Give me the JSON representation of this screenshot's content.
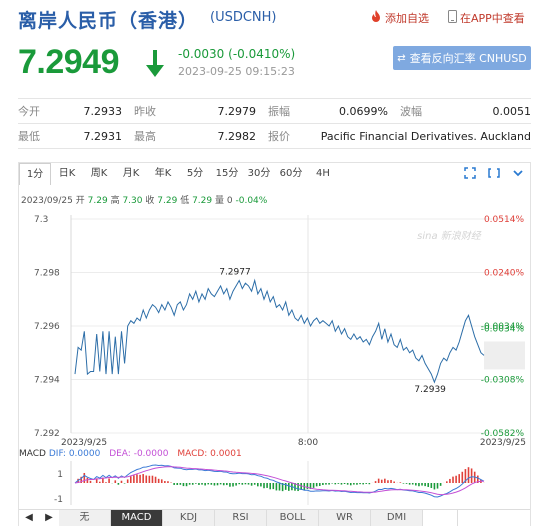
{
  "header": {
    "title": "离岸人民币（香港）",
    "code": "(USDCNH)",
    "favorite_label": "添加自选",
    "app_label": "在APP中查看"
  },
  "quote": {
    "price": "7.2949",
    "change": "-0.0030 (-0.0410%)",
    "time": "2023-09-25 09:15:23",
    "cross_label": "查看反向汇率 CNHUSD",
    "rows": [
      [
        {
          "label": "今开",
          "value": "7.2933"
        },
        {
          "label": "昨收",
          "value": "7.2979"
        },
        {
          "label": "振幅",
          "value": "0.0699%"
        },
        {
          "label": "波幅",
          "value": "0.0051"
        }
      ],
      [
        {
          "label": "最低",
          "value": "7.2931"
        },
        {
          "label": "最高",
          "value": "7.2982"
        },
        {
          "label": "报价",
          "value": "Pacific Financial Derivatives. Auckland"
        }
      ]
    ]
  },
  "chart": {
    "tabs": [
      "1分",
      "日K",
      "周K",
      "月K",
      "年K",
      "5分",
      "15分",
      "30分",
      "60分",
      "4H"
    ],
    "active_tab": "1分",
    "info": {
      "date": "2023/09/25",
      "open_label": "开",
      "open": "7.29",
      "high_label": "高",
      "high": "7.30",
      "close_label": "收",
      "close": "7.29",
      "low_label": "低",
      "low": "7.29",
      "vol_label": "量",
      "vol": "0",
      "pct": "-0.04%"
    },
    "watermark": "sina 新浪财经",
    "high_marker": "7.2977",
    "low_marker": "7.2939",
    "x_labels": [
      "2023/9/25",
      "8:00",
      "2023/9/25"
    ],
    "indicator_tabs": [
      "无",
      "MACD",
      "KDJ",
      "RSI",
      "BOLL",
      "WR",
      "DMI"
    ],
    "active_indicator": "MACD",
    "macd_legend": {
      "name": "MACD",
      "dif": "DIF: 0.0000",
      "dea": "DEA: -0.0000",
      "macd": "MACD: 0.0001"
    },
    "macd_ticks": [
      "1",
      "-1"
    ],
    "colors": {
      "line": "#2d6ea8",
      "up": "#e0403a",
      "down": "#1a9a3a",
      "dif": "#3b7ad6",
      "dea": "#c34fd6"
    }
  },
  "chart_data": {
    "type": "line",
    "title": "",
    "xlabel": "",
    "ylabel": "",
    "x_range": [
      "2023/9/25",
      "2023/9/25"
    ],
    "ylim": [
      7.292,
      7.3
    ],
    "y_ticks_left": [
      "7.3",
      "7.298",
      "7.296",
      "7.294",
      "7.292"
    ],
    "y_ticks_right": [
      "0.0514%",
      "0.0240%",
      "-0.0034%",
      "-0.0308%",
      "-0.0582%"
    ],
    "right_tick_colors": [
      "#e0403a",
      "#e0403a",
      "#1a9a3a",
      "#1a9a3a",
      "#1a9a3a"
    ],
    "prev_close": 7.2979,
    "current_pct_label": "-0.0034%",
    "series": [
      {
        "values": [
          7.2942,
          7.2952,
          7.2951,
          7.2958,
          7.2942,
          7.2943,
          7.2943,
          7.2957,
          7.2943,
          7.2958,
          7.2942,
          7.2958,
          7.2942,
          7.2956,
          7.2942,
          7.2958,
          7.2946,
          7.296,
          7.2962,
          7.2961,
          7.2963,
          7.2962,
          7.2966,
          7.2963,
          7.2966,
          7.2968,
          7.2967,
          7.2965,
          7.2968,
          7.2966,
          7.2969,
          7.2967,
          7.2964,
          7.2968,
          7.2969,
          7.2966,
          7.2968,
          7.2972,
          7.297,
          7.2973,
          7.2969,
          7.2972,
          7.297,
          7.2974,
          7.2972,
          7.2971,
          7.2973,
          7.2975,
          7.2972,
          7.2974,
          7.297,
          7.2973,
          7.2975,
          7.2977,
          7.2974,
          7.2976,
          7.2975,
          7.2973,
          7.2977,
          7.2972,
          7.2974,
          7.297,
          7.2973,
          7.2969,
          7.2971,
          7.2967,
          7.2968,
          7.2966,
          7.2969,
          7.2964,
          7.2966,
          7.2963,
          7.2962,
          7.2964,
          7.2961,
          7.2963,
          7.296,
          7.2962,
          7.2963,
          7.2961,
          7.2962,
          7.2961,
          7.296,
          7.2962,
          7.2958,
          7.296,
          7.2957,
          7.2959,
          7.2956,
          7.2955,
          7.2957,
          7.2955,
          7.2956,
          7.2954,
          7.2955,
          7.2953,
          7.2956,
          7.2958,
          7.2961,
          7.2955,
          7.2959,
          7.2954,
          7.2957,
          7.2953,
          7.2952,
          7.2955,
          7.2951,
          7.2952,
          7.295,
          7.2951,
          7.2948,
          7.2947,
          7.2949,
          7.2946,
          7.2944,
          7.2942,
          7.2939,
          7.2942,
          7.2946,
          7.2948,
          7.2947,
          7.295,
          7.2952,
          7.2951,
          7.2954,
          7.2958,
          7.2962,
          7.2964,
          7.296,
          7.2956,
          7.2953,
          7.295,
          7.2949
        ]
      }
    ]
  }
}
